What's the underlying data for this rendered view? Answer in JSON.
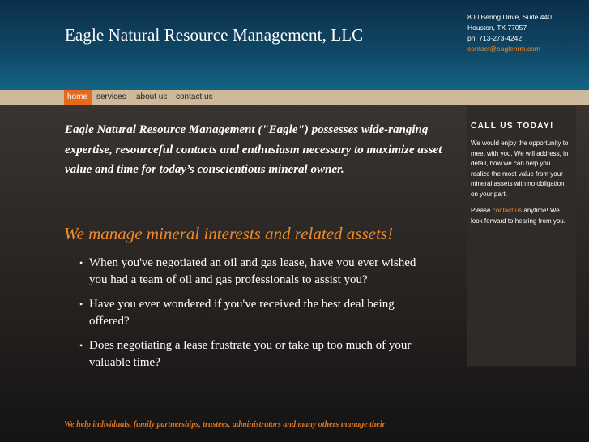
{
  "header": {
    "title": "Eagle Natural Resource Management, LLC",
    "address_line1": "800 Bering Drive, Suite 440",
    "address_line2": "Houston, TX 77057",
    "phone": "ph: 713-273-4242",
    "email": "contact@eaglenrm.com"
  },
  "nav": {
    "items": [
      {
        "label": "home",
        "active": true
      },
      {
        "label": "services"
      },
      {
        "label": "about us"
      },
      {
        "label": "contact us"
      }
    ]
  },
  "main": {
    "intro": "Eagle Natural Resource Management (\"Eagle\") possesses wide-ranging expertise, resourceful contacts and enthusiasm necessary to maximize asset value and time for today’s conscientious mineral owner.",
    "headline": "We manage mineral interests and related assets!",
    "bullets": [
      "When you've negotiated an oil and gas lease, have you ever wished you had a team of oil and gas professionals to assist you?",
      "Have you ever wondered if you've received the best deal being offered?",
      "Does negotiating a lease frustrate you or take up too much of your valuable time?"
    ],
    "footer_text": "We help individuals, family partnerships, trustees, administrators and many others manage their"
  },
  "sidebar": {
    "title": "CALL US TODAY!",
    "para1": "We would enjoy the opportunity to meet with you.  We will address, in detail, how we can help you realize the most value from your mineral assets with no obligation on your part.",
    "para2_prefix": "Please ",
    "para2_link": "contact us",
    "para2_suffix": " anytime! We look forward to hearing from you."
  },
  "colors": {
    "accent_orange": "#e8691e",
    "header_blue": "#0f4664",
    "nav_tan": "#cdb99c"
  }
}
